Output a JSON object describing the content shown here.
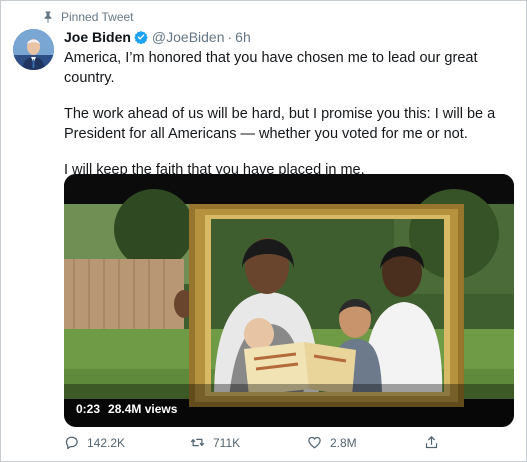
{
  "pinned": {
    "label": "Pinned Tweet"
  },
  "author": {
    "display_name": "Joe Biden",
    "handle": "@JoeBiden",
    "separator": "·",
    "time": "6h"
  },
  "tweet": {
    "paragraphs": [
      "America, I’m honored that you have chosen me to lead our great country.",
      "The work ahead of us will be hard, but I promise you this: I will be a President for all Americans — whether you voted for me or not.",
      "I will keep the faith that you have placed in me."
    ]
  },
  "video": {
    "duration": "0:23",
    "views": "28.4M views"
  },
  "actions": {
    "reply": "142.2K",
    "retweet": "711K",
    "like": "2.8M"
  },
  "colors": {
    "verified": "#1da1f2",
    "muted": "#657786",
    "border": "#c7ccd1"
  }
}
